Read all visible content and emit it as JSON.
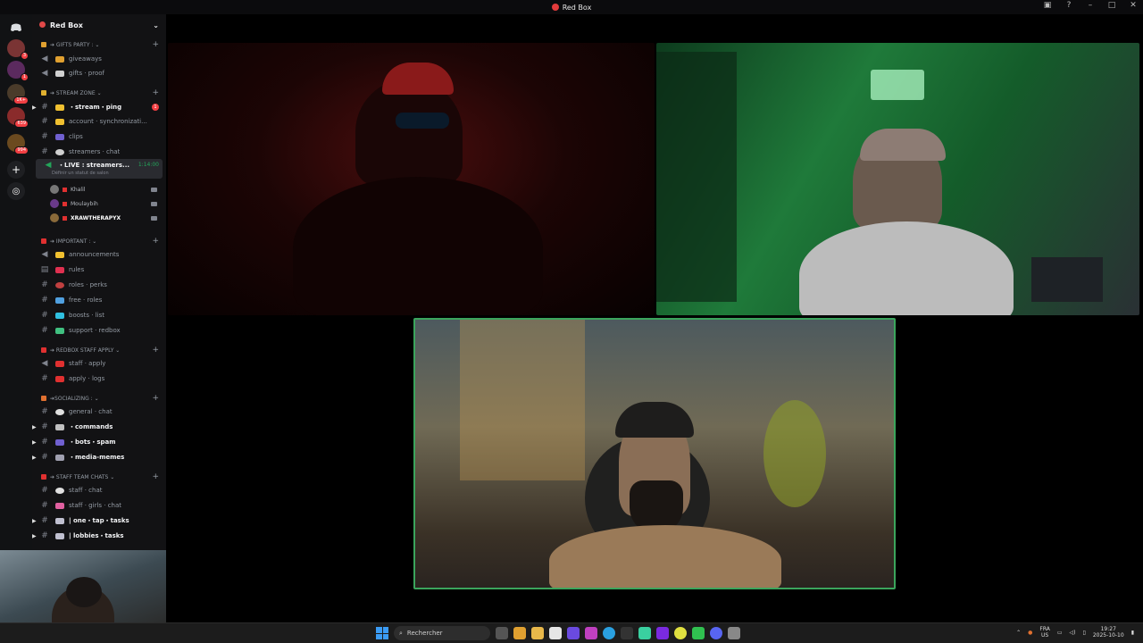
{
  "window": {
    "title": "Red Box"
  },
  "server_rail": {
    "items": [
      {
        "icon": "discord-icon",
        "badge": ""
      },
      {
        "icon": "server-icon",
        "badge": "3"
      },
      {
        "icon": "server-icon",
        "badge": "1"
      },
      {
        "icon": "server-icon",
        "badge": "1K+"
      },
      {
        "icon": "server-icon",
        "badge": "639"
      },
      {
        "icon": "server-icon",
        "badge": "994"
      },
      {
        "icon": "add-server-icon",
        "badge": ""
      },
      {
        "icon": "discover-icon",
        "badge": ""
      }
    ]
  },
  "sidebar": {
    "server_name": "Red Box",
    "categories": {
      "gifts": "➔ GIFTS PARTY : ⌄",
      "stream": "➔ STREAM ZONE ⌄",
      "important": "➔ IMPORTANT : ⌄",
      "staff_apply": "➔ REDBOX STAFF APPLY ⌄",
      "socializing": "➔SOCIALIZING : ⌄",
      "staff_team": "➔ STAFF TEAM CHATS ⌄"
    },
    "channels": {
      "giveaways": "giveaways",
      "gifts_proof": "gifts · proof",
      "stream_ping": "・stream・ping",
      "account_sync": "account · synchronizati...",
      "clips": "clips",
      "streamers_chat": "streamers · chat",
      "live_voice": "・LIVE   : streamers...",
      "live_time": "1:14:00",
      "live_status": "Définir un statut de salon",
      "announcements": "announcements",
      "rules": "rules",
      "roles_perks": "roles · perks",
      "free_roles": "free · roles",
      "boosts_list": "boosts · list",
      "support_redbox": "support · redbox",
      "staff_apply": "staff · apply",
      "apply_logs": "apply · logs",
      "general_chat": "general · chat",
      "commands": "・commands",
      "bots_spam": "・bots・spam",
      "media_memes": "・media-memes",
      "staff_chat": "staff · chat",
      "staff_girls_chat": "staff · girls · chat",
      "one_tap_tasks": "| one・tap・tasks",
      "lobbies_tasks": "| lobbies・tasks"
    },
    "ping_count": "1",
    "voice_users": [
      "Khalil",
      "Moulaybih",
      "XRAWTHERAPYX"
    ]
  },
  "taskbar": {
    "search_placeholder": "Rechercher",
    "lang_top": "FRA",
    "lang_bottom": "US",
    "time": "19:27",
    "date": "2025-10-10"
  },
  "colors": {
    "accent_red": "#e23b3b",
    "speaking_green": "#3ba55c",
    "sidebar_bg": "#121214"
  }
}
